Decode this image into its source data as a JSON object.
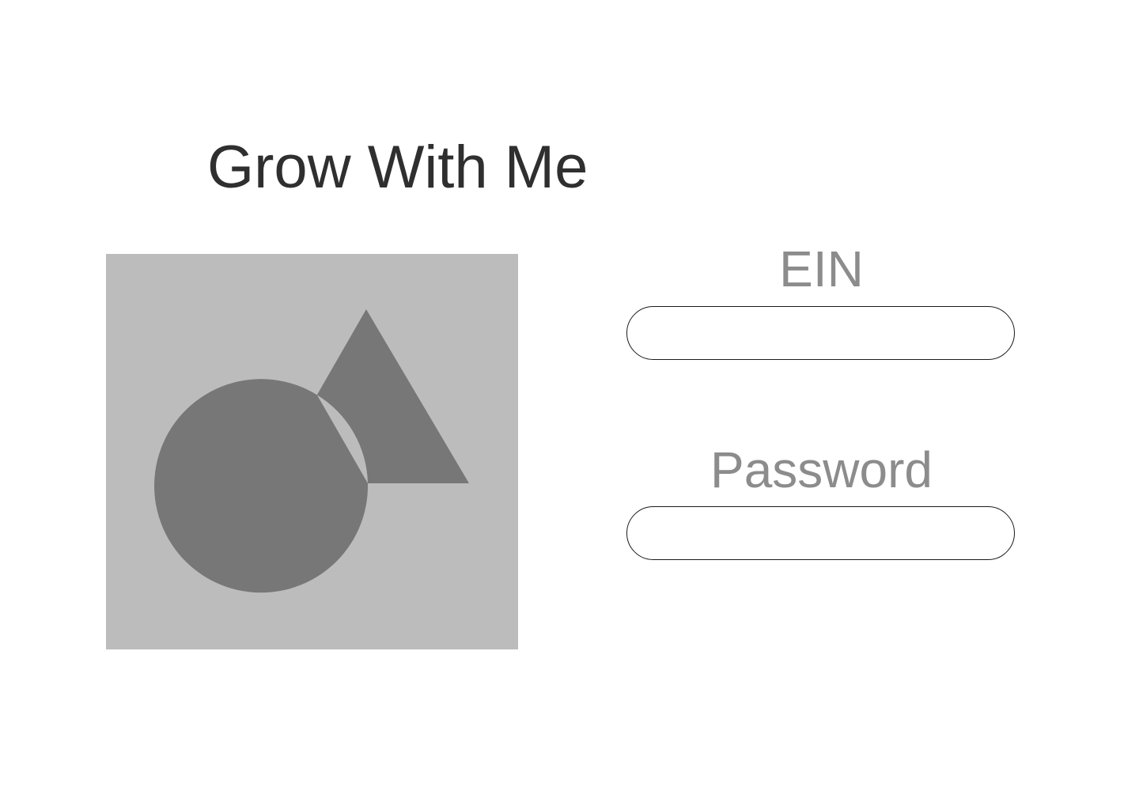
{
  "app": {
    "title": "Grow With Me"
  },
  "logo": {
    "icon": "image-placeholder-icon",
    "background_color": "#bcbcbc",
    "shape_color": "#777777"
  },
  "login_form": {
    "ein": {
      "label": "EIN",
      "value": "",
      "placeholder": ""
    },
    "password": {
      "label": "Password",
      "value": "",
      "placeholder": ""
    }
  }
}
